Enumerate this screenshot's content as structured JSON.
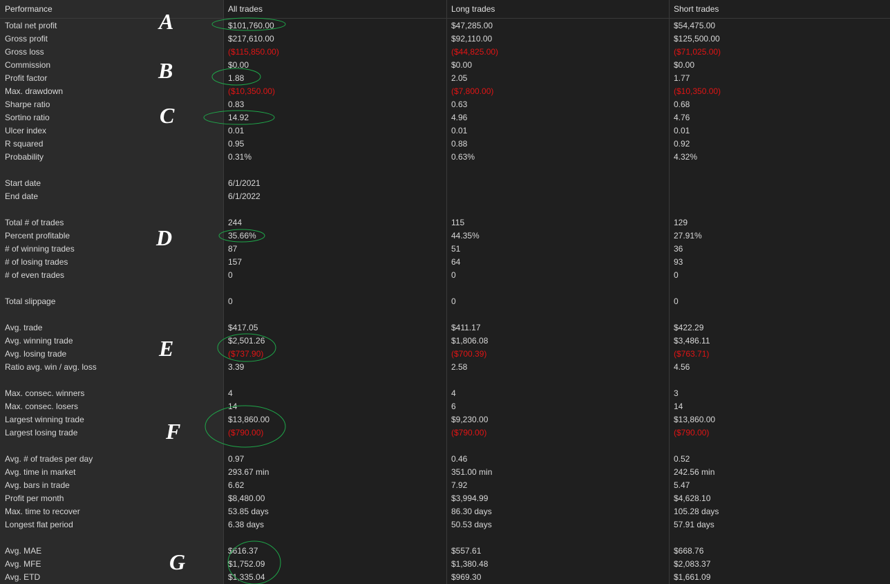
{
  "headers": [
    "Performance",
    "All trades",
    "Long trades",
    "Short trades"
  ],
  "rows": [
    {
      "label": "Total net profit",
      "all": "$101,760.00",
      "long": "$47,285.00",
      "short": "$54,475.00"
    },
    {
      "label": "Gross profit",
      "all": "$217,610.00",
      "long": "$92,110.00",
      "short": "$125,500.00"
    },
    {
      "label": "Gross loss",
      "all": "($115,850.00)",
      "long": "($44,825.00)",
      "short": "($71,025.00)",
      "negative": true
    },
    {
      "label": "Commission",
      "all": "$0.00",
      "long": "$0.00",
      "short": "$0.00"
    },
    {
      "label": "Profit factor",
      "all": "1.88",
      "long": "2.05",
      "short": "1.77"
    },
    {
      "label": "Max. drawdown",
      "all": "($10,350.00)",
      "long": "($7,800.00)",
      "short": "($10,350.00)",
      "negative": true
    },
    {
      "label": "Sharpe ratio",
      "all": "0.83",
      "long": "0.63",
      "short": "0.68"
    },
    {
      "label": "Sortino ratio",
      "all": "14.92",
      "long": "4.96",
      "short": "4.76"
    },
    {
      "label": "Ulcer index",
      "all": "0.01",
      "long": "0.01",
      "short": "0.01"
    },
    {
      "label": "R squared",
      "all": "0.95",
      "long": "0.88",
      "short": "0.92"
    },
    {
      "label": "Probability",
      "all": "0.31%",
      "long": "0.63%",
      "short": "4.32%"
    },
    {
      "label": "",
      "all": "",
      "long": "",
      "short": ""
    },
    {
      "label": "Start date",
      "all": "6/1/2021",
      "long": "",
      "short": ""
    },
    {
      "label": "End date",
      "all": "6/1/2022",
      "long": "",
      "short": ""
    },
    {
      "label": "",
      "all": "",
      "long": "",
      "short": ""
    },
    {
      "label": "Total # of trades",
      "all": "244",
      "long": "115",
      "short": "129"
    },
    {
      "label": "Percent profitable",
      "all": "35.66%",
      "long": "44.35%",
      "short": "27.91%"
    },
    {
      "label": "# of winning trades",
      "all": "87",
      "long": "51",
      "short": "36"
    },
    {
      "label": "# of losing trades",
      "all": "157",
      "long": "64",
      "short": "93"
    },
    {
      "label": "# of even trades",
      "all": "0",
      "long": "0",
      "short": "0"
    },
    {
      "label": "",
      "all": "",
      "long": "",
      "short": ""
    },
    {
      "label": "Total slippage",
      "all": "0",
      "long": "0",
      "short": "0"
    },
    {
      "label": "",
      "all": "",
      "long": "",
      "short": ""
    },
    {
      "label": "Avg. trade",
      "all": "$417.05",
      "long": "$411.17",
      "short": "$422.29"
    },
    {
      "label": "Avg. winning trade",
      "all": "$2,501.26",
      "long": "$1,806.08",
      "short": "$3,486.11"
    },
    {
      "label": "Avg. losing trade",
      "all": "($737.90)",
      "long": "($700.39)",
      "short": "($763.71)",
      "negative": true
    },
    {
      "label": "Ratio avg. win / avg. loss",
      "all": "3.39",
      "long": "2.58",
      "short": "4.56"
    },
    {
      "label": "",
      "all": "",
      "long": "",
      "short": ""
    },
    {
      "label": "Max. consec. winners",
      "all": "4",
      "long": "4",
      "short": "3"
    },
    {
      "label": "Max. consec. losers",
      "all": "14",
      "long": "6",
      "short": "14"
    },
    {
      "label": "Largest winning trade",
      "all": "$13,860.00",
      "long": "$9,230.00",
      "short": "$13,860.00"
    },
    {
      "label": "Largest losing trade",
      "all": "($790.00)",
      "long": "($790.00)",
      "short": "($790.00)",
      "negative": true
    },
    {
      "label": "",
      "all": "",
      "long": "",
      "short": ""
    },
    {
      "label": "Avg. # of trades per day",
      "all": "0.97",
      "long": "0.46",
      "short": "0.52"
    },
    {
      "label": "Avg. time in market",
      "all": "293.67 min",
      "long": "351.00 min",
      "short": "242.56 min"
    },
    {
      "label": "Avg. bars in trade",
      "all": "6.62",
      "long": "7.92",
      "short": "5.47"
    },
    {
      "label": "Profit per month",
      "all": "$8,480.00",
      "long": "$3,994.99",
      "short": "$4,628.10"
    },
    {
      "label": "Max. time to recover",
      "all": "53.85 days",
      "long": "86.30 days",
      "short": "105.28 days"
    },
    {
      "label": "Longest flat period",
      "all": "6.38 days",
      "long": "50.53 days",
      "short": "57.91 days"
    },
    {
      "label": "",
      "all": "",
      "long": "",
      "short": ""
    },
    {
      "label": "Avg. MAE",
      "all": "$616.37",
      "long": "$557.61",
      "short": "$668.76"
    },
    {
      "label": "Avg. MFE",
      "all": "$1,752.09",
      "long": "$1,380.48",
      "short": "$2,083.37"
    },
    {
      "label": "Avg. ETD",
      "all": "$1,335.04",
      "long": "$969.30",
      "short": "$1,661.09"
    }
  ],
  "annotations": [
    "A",
    "B",
    "C",
    "D",
    "E",
    "F",
    "G"
  ],
  "colors": {
    "negative": "#e01414",
    "highlight_oval": "#1fa84a",
    "background": "#1f1f1f",
    "label_column": "#2b2b2b"
  }
}
